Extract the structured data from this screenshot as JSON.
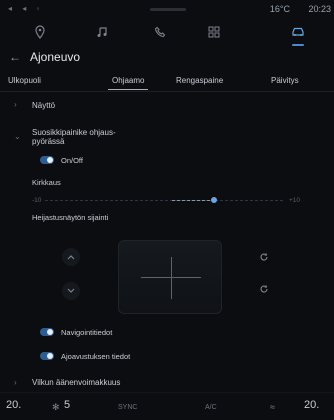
{
  "status": {
    "left_icons": "◂ ◂ ◦",
    "temperature": "16°C",
    "time": "20:23"
  },
  "nav": {
    "items": [
      {
        "name": "map-pin-icon",
        "active": false
      },
      {
        "name": "music-icon",
        "active": false
      },
      {
        "name": "phone-icon",
        "active": false
      },
      {
        "name": "apps-grid-icon",
        "active": false
      },
      {
        "name": "car-icon",
        "active": true
      }
    ]
  },
  "header": {
    "back": "←",
    "title": "Ajoneuvo"
  },
  "tabs": [
    {
      "label": "Ulkopuoli",
      "active": false
    },
    {
      "label": "Ohjaamo",
      "active": true
    },
    {
      "label": "Rengaspaine",
      "active": false
    },
    {
      "label": "Päivitys",
      "active": false
    }
  ],
  "rows": {
    "naytto": "Näyttö",
    "favorite_line1": "Suosikkipainike ohjaus-",
    "favorite_line2": "pyörässä",
    "onoff": "On/Off",
    "brightness": "Kirkkaus",
    "brightness_min": "-10",
    "brightness_max": "+10",
    "hud_position": "Heijastusnäytön sijainti",
    "navigation_info": "Navigointitiedot",
    "driving_assist_info": "Ajoavustuksen tiedot",
    "volume": "Vilkun äänenvoimakkuus"
  },
  "bottom": {
    "left_temp": "20.",
    "fan": "5",
    "sync": "SYNC",
    "ac": "A/C",
    "right_temp": "20."
  },
  "colors": {
    "accent": "#4b8ad0",
    "background": "#0b0d10"
  }
}
